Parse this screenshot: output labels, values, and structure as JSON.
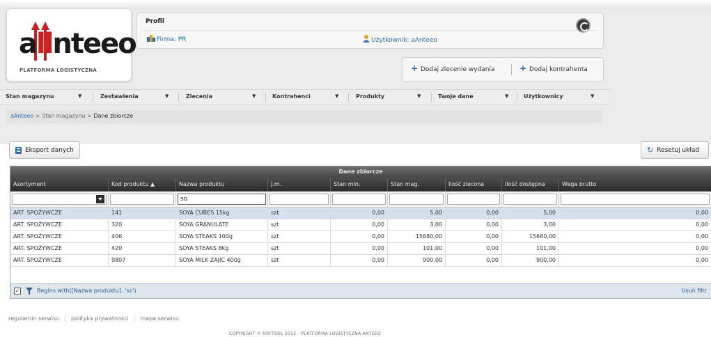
{
  "logo": {
    "lead": "a",
    "accent": "ll",
    "rest": "nteeo",
    "subtitle": "PLATFORMA LOGISTYCZNA"
  },
  "profile": {
    "title": "Profil",
    "firm_label": "Firma:",
    "firm_value": "PR",
    "user_label": "Użytkownik:",
    "user_value": "aAnteeo"
  },
  "actions": {
    "add_order": "Dodaj zlecenie wydania",
    "add_contractor": "Dodaj kontrahenta"
  },
  "nav": [
    {
      "label": "Stan magazynu"
    },
    {
      "label": "Zestawienia"
    },
    {
      "label": "Zlecenia"
    },
    {
      "label": "Kontrahenci"
    },
    {
      "label": "Produkty"
    },
    {
      "label": "Twoje dane"
    },
    {
      "label": "Użytkownicy"
    }
  ],
  "breadcrumb": {
    "root": "aAnteeo",
    "sep": ">",
    "middle": "Stan magazynu",
    "current": "Dane zbiorcze"
  },
  "toolbar": {
    "export_label": "Eksport danych",
    "reset_label": "Resetuj układ"
  },
  "grid": {
    "title": "Dane zbiorcze",
    "columns": [
      "Asortyment",
      "Kod produktu",
      "Nazwa produktu",
      "J.m.",
      "Stan min.",
      "Stan mag.",
      "Ilość zlecona",
      "Ilość dostępna",
      "Waga brutto"
    ],
    "sort_indicator": "▲",
    "filter_value": "so",
    "rows": [
      [
        "ART. SPOŻYWCZE",
        "141",
        "SOYA CUBES 15kg",
        "szt",
        "0,00",
        "5,00",
        "0,00",
        "5,00",
        "0,00"
      ],
      [
        "ART. SPOŻYWCZE",
        "320",
        "SOYA GRANULATE",
        "szt",
        "0,00",
        "3,00",
        "0,00",
        "3,00",
        "0,00"
      ],
      [
        "ART. SPOŻYWCZE",
        "406",
        "SOYA STEAKS 100g",
        "szt",
        "0,00",
        "15680,00",
        "0,00",
        "15680,00",
        "0,00"
      ],
      [
        "ART. SPOŻYWCZE",
        "420",
        "SOYA STEAKS 8kg",
        "szt",
        "0,00",
        "101,00",
        "0,00",
        "101,00",
        "0,00"
      ],
      [
        "ART. SPOŻYWCZE",
        "9807",
        "SOYA MILK ZAJIC 400g",
        "szt",
        "0,00",
        "900,00",
        "0,00",
        "900,00",
        "0,00"
      ]
    ],
    "filter_summary": "Begins with([Nazwa produktu], 'so')",
    "clear_filter": "Usuń filtr"
  },
  "footer": {
    "links": [
      "regulamin serwisu",
      "polityka prywatności",
      "mapa serwisu"
    ],
    "copyright": "COPYRIGHT © SOFTSOL 2012 - PLATFORMA LOGISTYCZNA ANTEEO"
  },
  "colors": {
    "accent_blue": "#2d6db5",
    "logo_red": "#cc1f1f",
    "selected_row": "#d5e0ec",
    "grid_header": "#2a2a2a"
  }
}
